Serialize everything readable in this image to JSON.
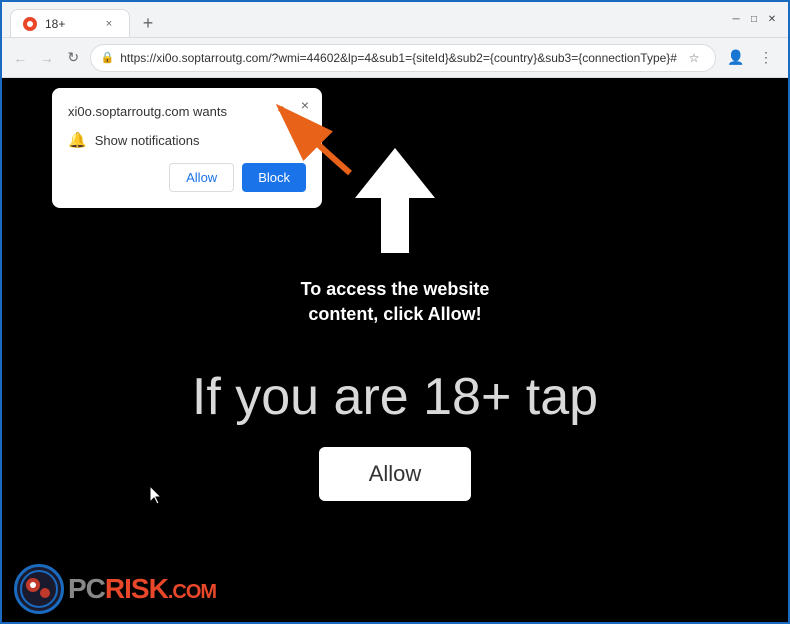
{
  "browser": {
    "tab_title": "18+",
    "tab_close_label": "×",
    "new_tab_label": "+",
    "url": "https://xi0o.soptarroutg.com/?wmi=44602&lp=4&sub1={siteId}&sub2={country}&sub3={connectionType}#",
    "back_btn": "←",
    "forward_btn": "→",
    "reload_btn": "↻",
    "window_minimize": "─",
    "window_maximize": "□",
    "window_close": "✕"
  },
  "popup": {
    "title": "xi0o.soptarroutg.com wants",
    "close_btn": "×",
    "notification_label": "Show notifications",
    "allow_label": "Allow",
    "block_label": "Block"
  },
  "page": {
    "instruction_text": "To access the website\ncontent, click Allow!",
    "age_text": "If you are 18+ tap",
    "allow_cta_label": "Allow"
  },
  "watermark": {
    "text_pc": "PC",
    "text_risk": "RISK",
    "text_dot_com": ".COM"
  }
}
